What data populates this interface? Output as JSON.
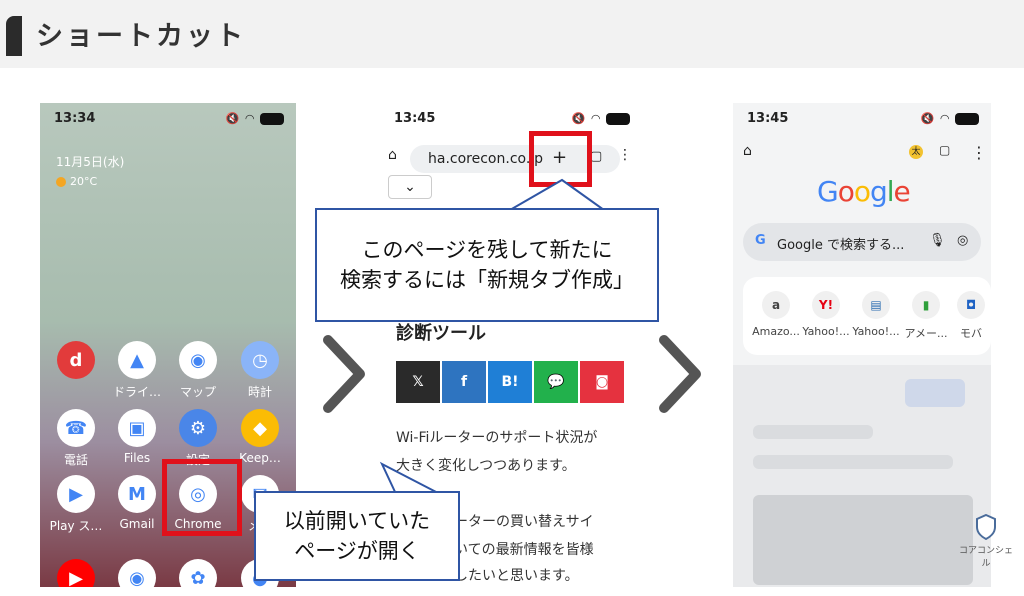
{
  "header": {
    "title": "ショートカット"
  },
  "phone1": {
    "time": "13:34",
    "date": "11月5日(水)",
    "weather": "20°C",
    "apps": [
      {
        "label": "",
        "icon": "docomo-folder-icon",
        "color": "#e23b3b",
        "glyph": "d"
      },
      {
        "label": "ドライ…",
        "icon": "google-drive-icon",
        "color": "#fff",
        "glyph": "▲"
      },
      {
        "label": "マップ",
        "icon": "google-maps-icon",
        "color": "#fff",
        "glyph": "◉"
      },
      {
        "label": "時計",
        "icon": "clock-icon",
        "color": "#8ab4f8",
        "glyph": "◷"
      },
      {
        "label": "電話",
        "icon": "phone-icon",
        "color": "#fff",
        "glyph": "☎"
      },
      {
        "label": "Files",
        "icon": "files-icon",
        "color": "#fff",
        "glyph": "▣"
      },
      {
        "label": "設定",
        "icon": "settings-gear-icon",
        "color": "#4a86e8",
        "glyph": "⚙"
      },
      {
        "label": "Keep…",
        "icon": "keep-icon",
        "color": "#fbbc04",
        "glyph": "◆"
      },
      {
        "label": "Play ス…",
        "icon": "play-store-icon",
        "color": "#fff",
        "glyph": "▶"
      },
      {
        "label": "Gmail",
        "icon": "gmail-icon",
        "color": "#fff",
        "glyph": "M"
      },
      {
        "label": "Chrome",
        "icon": "chrome-icon",
        "color": "#fff",
        "glyph": "◎"
      },
      {
        "label": "メ…",
        "icon": "messages-icon",
        "color": "#fff",
        "glyph": "✉"
      },
      {
        "label": "",
        "icon": "youtube-icon",
        "color": "#ff0000",
        "glyph": "▶"
      },
      {
        "label": "",
        "icon": "camera-icon",
        "color": "#fff",
        "glyph": "◉"
      },
      {
        "label": "",
        "icon": "photos-icon",
        "color": "#fff",
        "glyph": "✿"
      },
      {
        "label": "",
        "icon": "app-icon",
        "color": "#fff",
        "glyph": "●"
      }
    ]
  },
  "phone2": {
    "time": "13:45",
    "url": "ha.corecon.co.jp",
    "plus": "+",
    "section_title": "診断ツール",
    "share_buttons": [
      {
        "label": "𝕏",
        "color": "#2a2a2a"
      },
      {
        "label": "f",
        "color": "#2e74c0"
      },
      {
        "label": "B!",
        "color": "#1f7fd6"
      },
      {
        "label": "💬",
        "color": "#22b14c"
      },
      {
        "label": "◙",
        "color": "#e5323f"
      }
    ],
    "lines": [
      "Wi-Fiルーターのサポート状況が",
      "大きく変化しつつあります。",
      "ーターの買い替えサイ",
      "いての最新情報を皆様",
      "したいと思います。"
    ]
  },
  "phone3": {
    "time": "13:45",
    "logo": "Google",
    "search_placeholder": "Google で検索する...",
    "tiles": [
      "Amazo...",
      "Yahoo!...",
      "Yahoo!...",
      "アメー...",
      "モバ"
    ]
  },
  "callouts": {
    "top": [
      "このページを残して新たに",
      "検索するには「新規タブ作成」"
    ],
    "bottom": [
      "以前開いていた",
      "ページが開く"
    ]
  },
  "brand": {
    "logo_text": "コアコンシェル"
  }
}
